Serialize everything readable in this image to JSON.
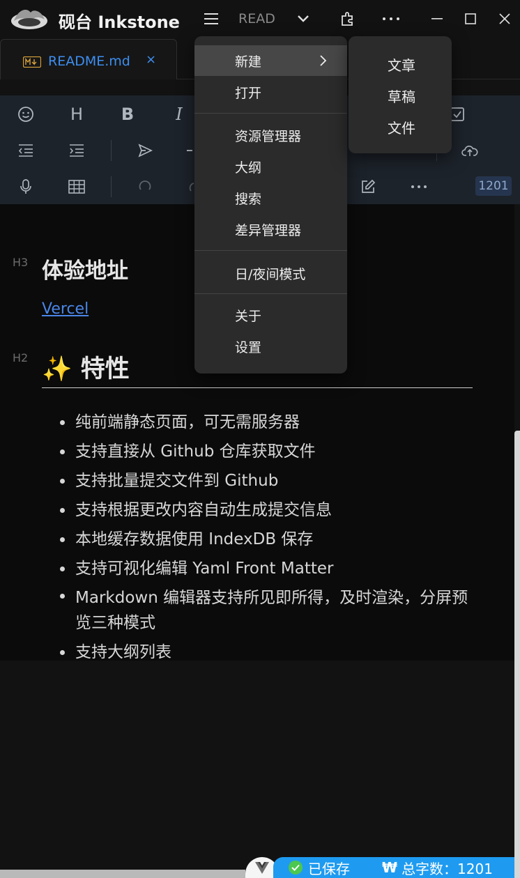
{
  "titlebar": {
    "app_title": "砚台 Inkstone",
    "doc_title_truncated": "READ"
  },
  "tabs": [
    {
      "label": "README.md",
      "close": "×"
    }
  ],
  "toolbar": {
    "heading_label": "H",
    "bold_label": "B",
    "italic_label": "I",
    "word_count_badge": "1201"
  },
  "menu": {
    "items": [
      {
        "label": "新建"
      },
      {
        "label": "打开"
      },
      {
        "label": "资源管理器"
      },
      {
        "label": "大纲"
      },
      {
        "label": "搜索"
      },
      {
        "label": "差异管理器"
      },
      {
        "label": "日/夜间模式"
      },
      {
        "label": "关于"
      },
      {
        "label": "设置"
      }
    ],
    "submenu": [
      {
        "label": "文章"
      },
      {
        "label": "草稿"
      },
      {
        "label": "文件"
      }
    ]
  },
  "editor": {
    "h3_tag": "H3",
    "h3_text": "体验地址",
    "link_text": "Vercel",
    "h2_tag": "H2",
    "h2_emoji": "✨",
    "h2_text": "特性",
    "features": [
      "纯前端静态页面，可无需服务器",
      "支持直接从 Github 仓库获取文件",
      "支持批量提交文件到 Github",
      "支持根据更改内容自动生成提交信息",
      "本地缓存数据使用 IndexDB 保存",
      "支持可视化编辑 Yaml Front Matter",
      "Markdown 编辑器支持所见即所得，及时渲染，分屏预览三种模式",
      "支持大纲列表"
    ]
  },
  "status": {
    "saved_label": "已保存",
    "word_count_label": "总字数：1201"
  }
}
